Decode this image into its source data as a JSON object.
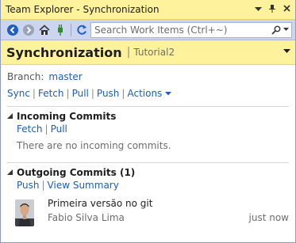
{
  "window": {
    "title": "Team Explorer - Synchronization",
    "accent": "#fff29d"
  },
  "toolbar": {
    "search_placeholder": "Search Work Items (Ctrl+~)",
    "icons": [
      "back-icon",
      "forward-icon",
      "home-icon",
      "connect-icon",
      "refresh-icon",
      "search-icon"
    ]
  },
  "header": {
    "title": "Synchronization",
    "subtitle": "Tutorial2"
  },
  "branch": {
    "label": "Branch:",
    "name": "master"
  },
  "actions": {
    "sync": "Sync",
    "fetch": "Fetch",
    "pull": "Pull",
    "push": "Push",
    "actions": "Actions"
  },
  "incoming": {
    "title": "Incoming Commits",
    "fetch": "Fetch",
    "pull": "Pull",
    "empty": "There are no incoming commits."
  },
  "outgoing": {
    "title": "Outgoing Commits (1)",
    "push": "Push",
    "view_summary": "View Summary",
    "commits": [
      {
        "message": "Primeira versão no git",
        "author": "Fabio Silva Lima",
        "time": "just now"
      }
    ]
  }
}
